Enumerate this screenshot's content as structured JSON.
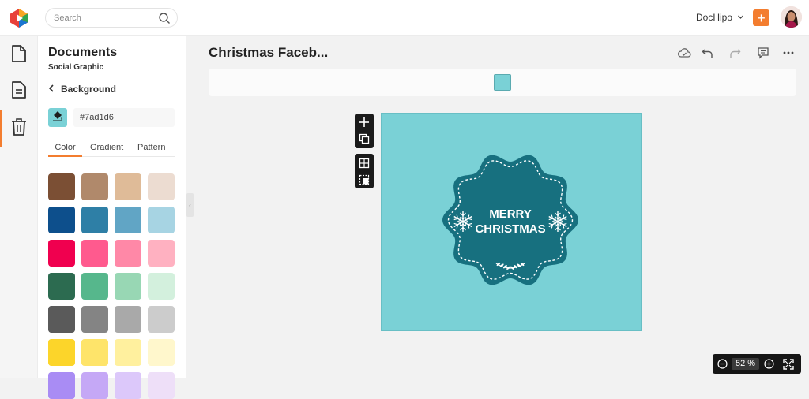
{
  "topbar": {
    "search_placeholder": "Search",
    "workspace_label": "DocHipo",
    "add_label": "+"
  },
  "sidebar": {
    "items": [
      {
        "icon": "document-icon"
      },
      {
        "icon": "design-icon"
      },
      {
        "icon": "trash-icon"
      }
    ],
    "active_index": 1
  },
  "panel": {
    "title": "Documents",
    "subtitle": "Social Graphic",
    "back_label": "Background",
    "current_color_hex": "#7ad1d6",
    "tabs": [
      {
        "label": "Color"
      },
      {
        "label": "Gradient"
      },
      {
        "label": "Pattern"
      }
    ],
    "active_tab": 0,
    "swatches": [
      [
        "#7b4f34",
        "#b0896b",
        "#dfbb98",
        "#ecdcd1"
      ],
      [
        "#0d4f8c",
        "#2e7fa6",
        "#61a5c5",
        "#a7d4e3"
      ],
      [
        "#f0004f",
        "#ff5a8e",
        "#ff88a7",
        "#ffb1c1"
      ],
      [
        "#2c6b50",
        "#56b78c",
        "#98d7b4",
        "#d3f0dd"
      ],
      [
        "#5a5a5a",
        "#848484",
        "#a9a9a9",
        "#cccccc"
      ],
      [
        "#fcd52a",
        "#fee46a",
        "#fff09e",
        "#fff7cc"
      ],
      [
        "#a98cf4",
        "#c5a8f6",
        "#dcc8fa",
        "#eedff8"
      ]
    ]
  },
  "editor": {
    "doc_title": "Christmas Faceb...",
    "toolbar_icons": [
      "cloud-save-icon",
      "undo-icon",
      "redo-icon",
      "comment-icon",
      "more-icon"
    ],
    "strip_color": "#7ad1d6",
    "canvas_bg": "#7ad1d6",
    "badge": {
      "line1": "MERRY",
      "line2": "CHRISTMAS",
      "color": "#17707f"
    },
    "zoom_value": "52",
    "zoom_unit": "%"
  }
}
